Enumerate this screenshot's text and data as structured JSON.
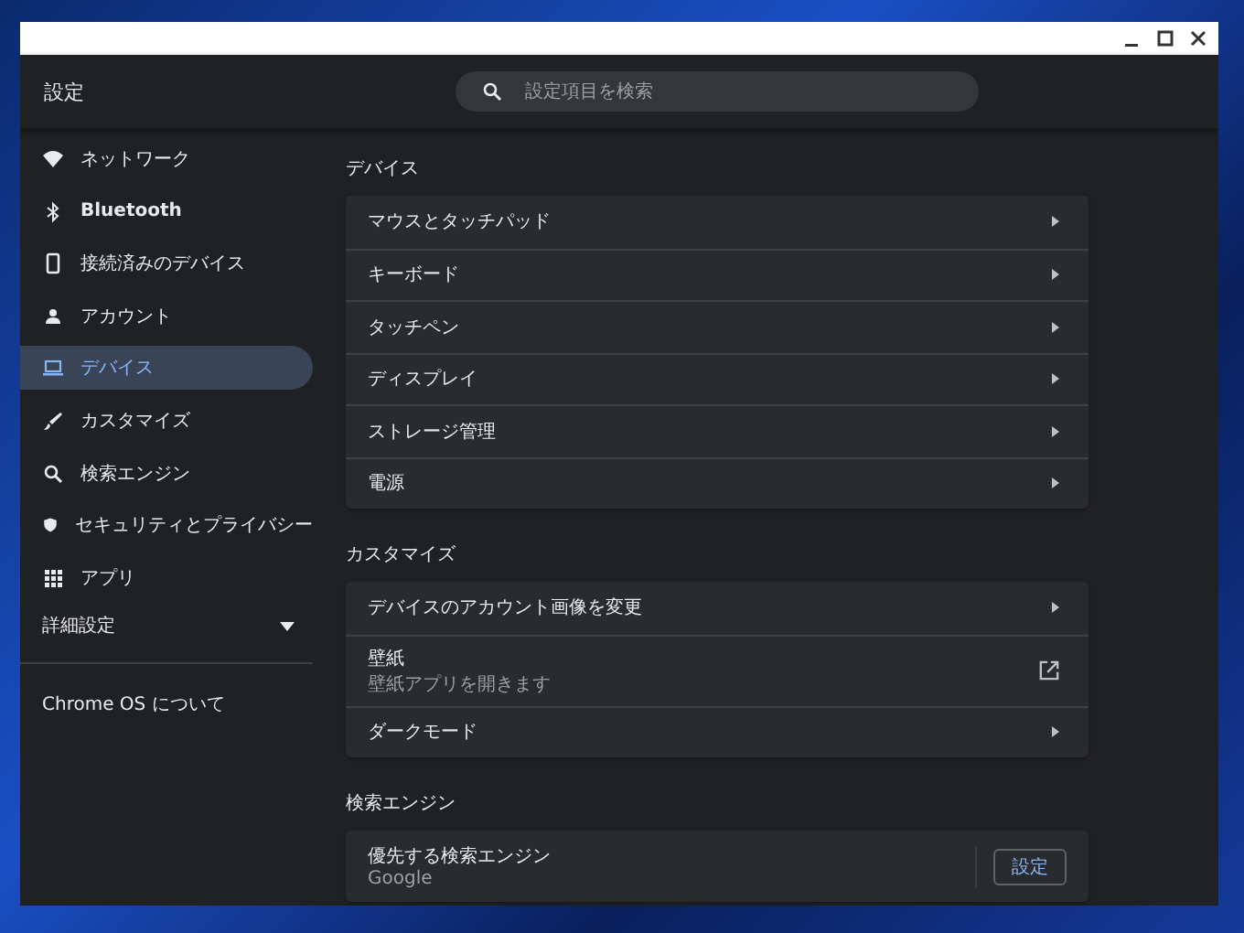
{
  "window": {
    "title": "設定"
  },
  "search": {
    "placeholder": "設定項目を検索"
  },
  "sidebar": {
    "items": [
      {
        "label": "ネットワーク",
        "selected": false
      },
      {
        "label": "Bluetooth",
        "selected": false
      },
      {
        "label": "接続済みのデバイス",
        "selected": false
      },
      {
        "label": "アカウント",
        "selected": false
      },
      {
        "label": "デバイス",
        "selected": true
      },
      {
        "label": "カスタマイズ",
        "selected": false
      },
      {
        "label": "検索エンジン",
        "selected": false
      },
      {
        "label": "セキュリティとプライバシー",
        "selected": false
      },
      {
        "label": "アプリ",
        "selected": false
      }
    ],
    "advanced": {
      "label": "詳細設定",
      "expanded": false
    },
    "about": "Chrome OS について"
  },
  "sections": [
    {
      "title": "デバイス",
      "rows": [
        {
          "kind": "link",
          "label": "マウスとタッチパッド"
        },
        {
          "kind": "link",
          "label": "キーボード"
        },
        {
          "kind": "link",
          "label": "タッチペン"
        },
        {
          "kind": "link",
          "label": "ディスプレイ"
        },
        {
          "kind": "link",
          "label": "ストレージ管理"
        },
        {
          "kind": "link",
          "label": "電源"
        }
      ]
    },
    {
      "title": "カスタマイズ",
      "rows": [
        {
          "kind": "link",
          "label": "デバイスのアカウント画像を変更"
        },
        {
          "kind": "external",
          "label": "壁紙",
          "sublabel": "壁紙アプリを開きます"
        },
        {
          "kind": "link",
          "label": "ダークモード"
        }
      ]
    },
    {
      "title": "検索エンジン",
      "rows": [
        {
          "kind": "button",
          "label": "優先する検索エンジン",
          "sublabel": "Google",
          "button": "設定"
        }
      ]
    }
  ]
}
